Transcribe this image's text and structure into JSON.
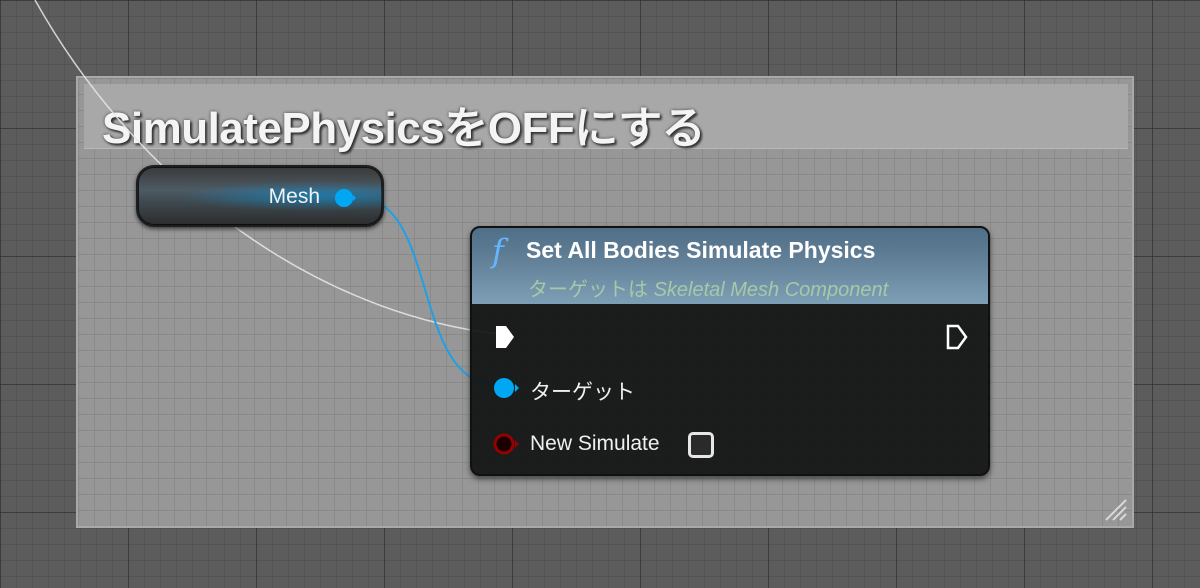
{
  "comment": {
    "title": "SimulatePhysicsをOFFにする"
  },
  "variable_node": {
    "label": "Mesh",
    "pin_color": "#00a8f3"
  },
  "function_node": {
    "icon": "f",
    "title": "Set All Bodies Simulate Physics",
    "subtitle_prefix": "ターゲットは ",
    "subtitle_class": "Skeletal Mesh Component",
    "header_color": "#5c7a92",
    "pins": {
      "target_label": "ターゲット",
      "new_simulate_label": "New Simulate"
    },
    "pin_colors": {
      "object": "#00a8f3",
      "boolean": "#950000",
      "exec": "#ffffff"
    }
  }
}
